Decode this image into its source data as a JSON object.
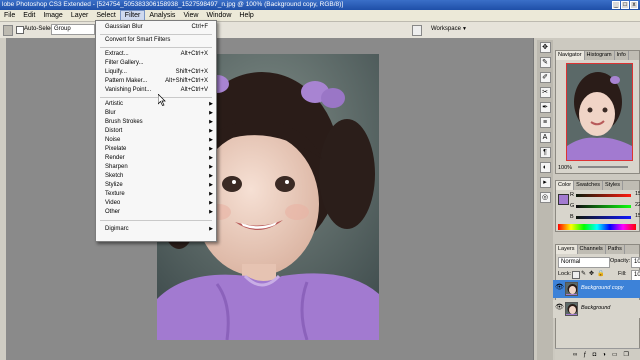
{
  "titlebar": {
    "title": "lobe Photoshop CS3 Extended - [524754_505383306158938_1527598497_n.jpg @ 100% (Background copy, RGB/8)]",
    "min": "_",
    "max": "□",
    "close": "x"
  },
  "menubar": {
    "items": [
      "File",
      "Edit",
      "Image",
      "Layer",
      "Select",
      "Filter",
      "Analysis",
      "View",
      "Window",
      "Help"
    ],
    "active": "Filter"
  },
  "options": {
    "auto_select": "Auto-Select:",
    "group": "Group",
    "workspace": "Workspace"
  },
  "filter_menu": {
    "last_filter": {
      "label": "Gaussian Blur",
      "shortcut": "Ctrl+F"
    },
    "smart": "Convert for Smart Filters",
    "plugins": [
      {
        "label": "Extract...",
        "shortcut": "Alt+Ctrl+X"
      },
      {
        "label": "Filter Gallery...",
        "shortcut": ""
      },
      {
        "label": "Liquify...",
        "shortcut": "Shift+Ctrl+X"
      },
      {
        "label": "Pattern Maker...",
        "shortcut": "Alt+Shift+Ctrl+X"
      },
      {
        "label": "Vanishing Point...",
        "shortcut": "Alt+Ctrl+V"
      }
    ],
    "groups": [
      "Artistic",
      "Blur",
      "Brush Strokes",
      "Distort",
      "Noise",
      "Pixelate",
      "Render",
      "Sharpen",
      "Sketch",
      "Stylize",
      "Texture",
      "Video",
      "Other"
    ],
    "digimarc": "Digimarc"
  },
  "navigator": {
    "tabs": [
      "Navigator",
      "Histogram",
      "Info"
    ],
    "zoom": "100%"
  },
  "color_panel": {
    "tabs": [
      "Color",
      "Swatches",
      "Styles"
    ],
    "channels": [
      "R",
      "G",
      "B"
    ],
    "values": [
      "15",
      "22",
      "15"
    ]
  },
  "layers_panel": {
    "tabs": [
      "Layers",
      "Channels",
      "Paths"
    ],
    "blend_mode": "Normal",
    "opacity_label": "Opacity:",
    "opacity": "10",
    "lock_label": "Lock:",
    "fill_label": "Fill:",
    "fill": "10",
    "layers": [
      {
        "name": "Background copy",
        "selected": true
      },
      {
        "name": "Background",
        "selected": false
      }
    ]
  },
  "colors": {
    "menu_highlight": "#316ac5",
    "layer_selected": "#3d82d8",
    "dress": "#a27ad0"
  }
}
